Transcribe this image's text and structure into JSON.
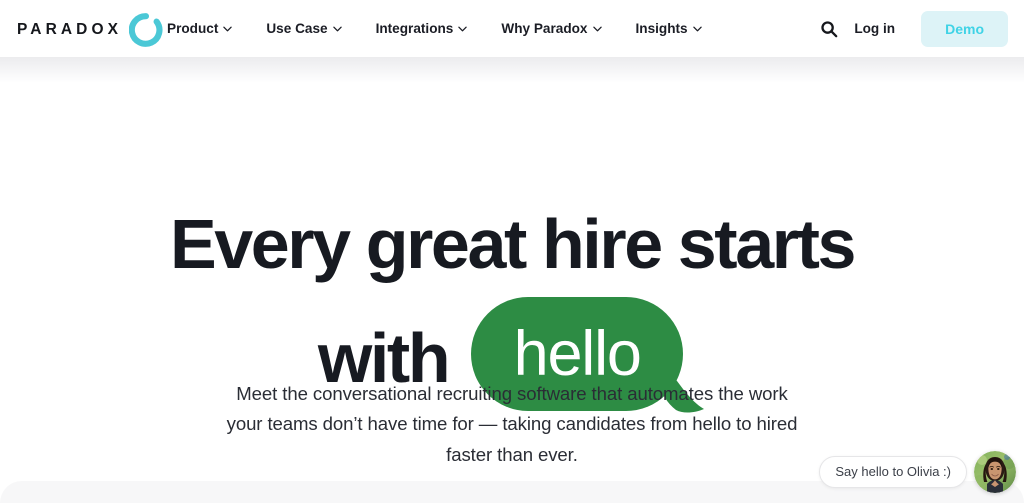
{
  "brand": {
    "logo_word": "PARADOX",
    "logo_mark_icon": "paradox-ring-icon",
    "accent_teal": "#4bc8d6",
    "accent_cyan": "#3fd3e6",
    "demo_bg": "#ddf3f7",
    "bubble_green": "#2d8c44",
    "headline_color": "#171a21"
  },
  "header": {
    "nav": [
      {
        "label": "Product",
        "has_dropdown": true
      },
      {
        "label": "Use Case",
        "has_dropdown": true
      },
      {
        "label": "Integrations",
        "has_dropdown": true
      },
      {
        "label": "Why Paradox",
        "has_dropdown": true
      },
      {
        "label": "Insights",
        "has_dropdown": true
      }
    ],
    "search_icon": "search-icon",
    "login_label": "Log in",
    "demo_label": "Demo"
  },
  "hero": {
    "headline_line1": "Every great hire starts",
    "headline_line2_prefix": "with",
    "bubble_text": "hello",
    "subheadline": "Meet the conversational recruiting software that automates the work your teams don’t have time for — taking candidates from hello to hired faster than ever."
  },
  "chat_widget": {
    "message": "Say hello to Olivia :)",
    "avatar_name": "olivia-avatar",
    "avatar_alt": "Olivia"
  }
}
